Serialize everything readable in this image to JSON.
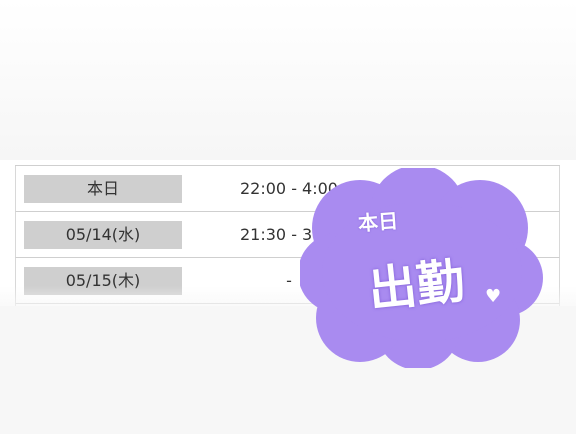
{
  "schedule": {
    "rows": [
      {
        "date": "本日",
        "time": "22:00 - 4:00"
      },
      {
        "date": "05/14(水)",
        "time": "21:30 - 3:00"
      },
      {
        "date": "05/15(木)",
        "time": "-"
      },
      {
        "date": "",
        "time": ""
      }
    ]
  },
  "sticker": {
    "small_text": "本日",
    "big_text": "出勤",
    "heart": "♥",
    "color": "#a98bf0"
  }
}
